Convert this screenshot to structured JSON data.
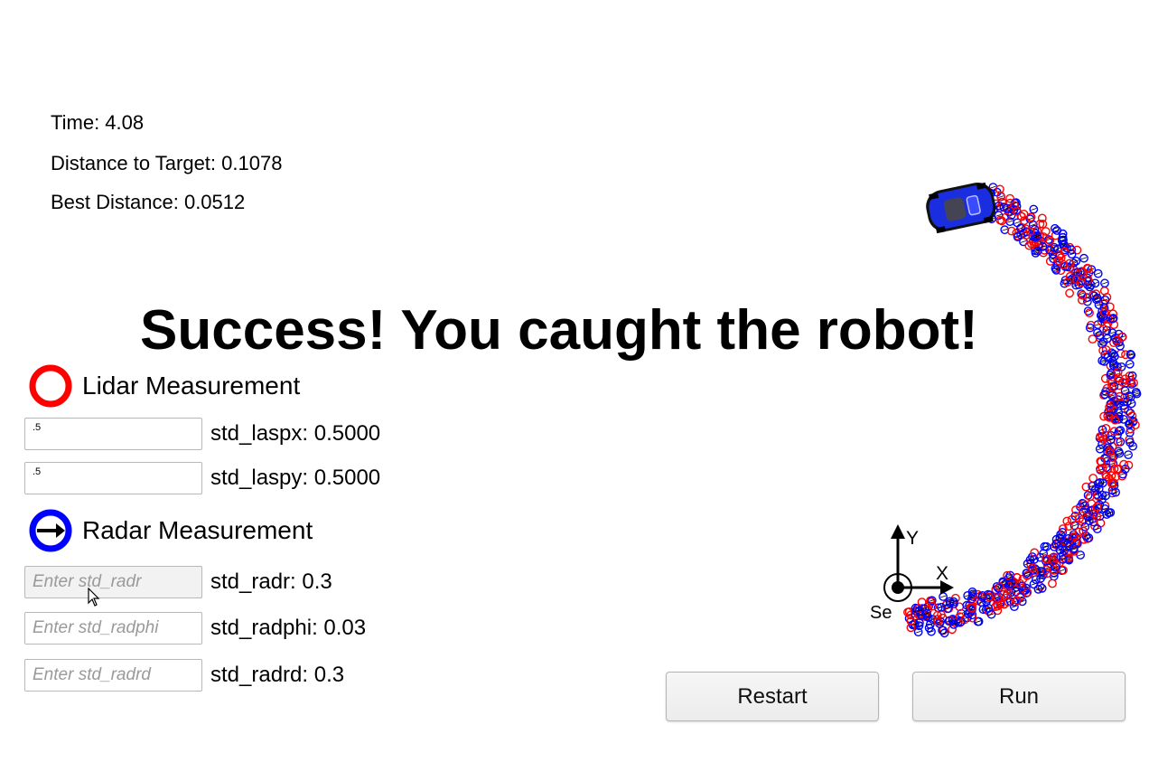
{
  "stats": {
    "time": "Time: 4.08",
    "distance": "Distance to Target: 0.1078",
    "best": "Best Distance: 0.0512"
  },
  "banner": "Success! You caught the robot!",
  "lidar": {
    "legend": "Lidar Measurement",
    "icon": "red-ring-icon",
    "color": "#ff0000",
    "fields": [
      {
        "value": ".5",
        "label": "std_laspx: 0.5000"
      },
      {
        "value": ".5",
        "label": "std_laspy: 0.5000"
      }
    ]
  },
  "radar": {
    "legend": "Radar Measurement",
    "icon": "blue-ring-arrow-icon",
    "color": "#0000ff",
    "fields": [
      {
        "placeholder": "Enter std_radr",
        "label": "std_radr: 0.3"
      },
      {
        "placeholder": "Enter std_radphi",
        "label": "std_radphi: 0.03"
      },
      {
        "placeholder": "Enter std_radrd",
        "label": "std_radrd: 0.3"
      }
    ]
  },
  "axes": {
    "y": "Y",
    "x": "X",
    "sensor": "Se"
  },
  "buttons": {
    "restart": "Restart",
    "run": "Run"
  },
  "robot": {
    "icon": "blue-car-icon",
    "color": "#1a2ee0"
  }
}
